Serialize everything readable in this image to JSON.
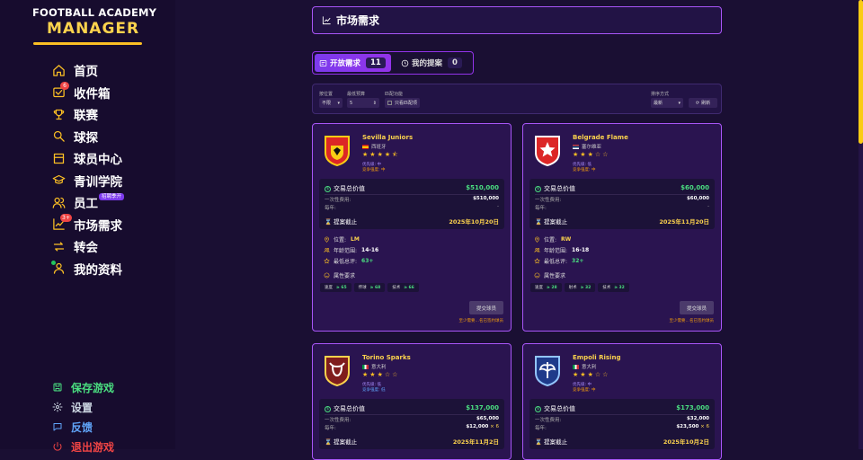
{
  "app": {
    "title_line1": "FOOTBALL ACADEMY",
    "title_line2": "MANAGER"
  },
  "sidebar": {
    "items": [
      {
        "label": "首页",
        "icon": "home-icon"
      },
      {
        "label": "收件箱",
        "icon": "inbox-icon",
        "badge": "6"
      },
      {
        "label": "联赛",
        "icon": "trophy-icon"
      },
      {
        "label": "球探",
        "icon": "search-icon"
      },
      {
        "label": "球员中心",
        "icon": "players-icon"
      },
      {
        "label": "青训学院",
        "icon": "graduation-cap-icon"
      },
      {
        "label": "员工",
        "icon": "staff-icon",
        "tag": "招聘季开"
      },
      {
        "label": "市场需求",
        "icon": "chart-icon",
        "badge": "3+"
      },
      {
        "label": "转会",
        "icon": "transfer-icon"
      },
      {
        "label": "我的资料",
        "icon": "user-icon"
      }
    ],
    "bottom": [
      {
        "label": "保存游戏",
        "icon": "save-icon",
        "color": "#4ade80"
      },
      {
        "label": "设置",
        "icon": "gear-icon",
        "color": "#cbd5e1"
      },
      {
        "label": "反馈",
        "icon": "chat-icon",
        "color": "#60a5fa"
      },
      {
        "label": "退出游戏",
        "icon": "power-icon",
        "color": "#ef4444"
      }
    ]
  },
  "header": {
    "title": "市场需求"
  },
  "tabs": [
    {
      "label": "开放需求",
      "count": "11"
    },
    {
      "label": "我的提案",
      "count": "0"
    }
  ],
  "filters": {
    "labels": [
      "position_label",
      "min_budget_label",
      "match_label",
      "sort_label"
    ],
    "position_label": "按位置",
    "position_value": "不限",
    "min_budget_label": "最低预算",
    "min_budget_value": "5",
    "match_label": "匹配功能",
    "match_value": "只看匹配项",
    "sort_label": "排序方式",
    "sort_value": "最新",
    "refresh_label": "刷新"
  },
  "labels": {
    "deal_total": "交易总价值",
    "one_time": "一次性费用:",
    "yearly": "每年:",
    "deadline": "提案截止",
    "position": "位置:",
    "age": "年龄范围:",
    "min_rating": "最低总评:",
    "attr_req": "属性要求",
    "submit": "提交球员",
    "footnote": "至少需要…名已签约球员"
  },
  "cards": [
    {
      "name": "Sevilla Juniors",
      "country": "西班牙",
      "rating": 4.5,
      "priority": "优先级: 中",
      "competition": "竞争强度: 中",
      "total": "$510,000",
      "one_time": "$510,000",
      "yearly": "-",
      "yearly_mult": "",
      "deadline": "2025年10月20日",
      "position": "LM",
      "age": "14-16",
      "min_rating": "63+",
      "attrs": [
        {
          "name": "速度",
          "value": "≥ 65"
        },
        {
          "name": "传球",
          "value": "≥ 68"
        },
        {
          "name": "技术",
          "value": "≥ 66"
        }
      ]
    },
    {
      "name": "Belgrade Flame",
      "country": "塞尔维亚",
      "rating": 3.0,
      "priority": "优先级: 低",
      "competition": "竞争强度: 中",
      "total": "$60,000",
      "one_time": "$60,000",
      "yearly": "-",
      "yearly_mult": "",
      "deadline": "2025年11月20日",
      "position": "RW",
      "age": "16-18",
      "min_rating": "32+",
      "attrs": [
        {
          "name": "速度",
          "value": "≥ 28"
        },
        {
          "name": "射术",
          "value": "≥ 32"
        },
        {
          "name": "技术",
          "value": "≥ 32"
        }
      ]
    },
    {
      "name": "Torino Sparks",
      "country": "意大利",
      "rating": 3.0,
      "priority": "优先级: 低",
      "competition": "竞争强度: 低",
      "total": "$137,000",
      "one_time": "$65,000",
      "yearly": "$12,000",
      "yearly_mult": "× 6",
      "deadline": "2025年11月2日",
      "position": "",
      "age": "",
      "min_rating": "",
      "attrs": []
    },
    {
      "name": "Empoli Rising",
      "country": "意大利",
      "rating": 3.0,
      "priority": "优先级: 中",
      "competition": "竞争强度: 中",
      "total": "$173,000",
      "one_time": "$32,000",
      "yearly": "$23,500",
      "yearly_mult": "× 6",
      "deadline": "2025年10月2日",
      "position": "",
      "age": "",
      "min_rating": "",
      "attrs": []
    }
  ],
  "colors": {
    "accent": "#a855f7",
    "gold": "#fbbf24",
    "money": "#4ade80",
    "background": "#1a0f33"
  }
}
